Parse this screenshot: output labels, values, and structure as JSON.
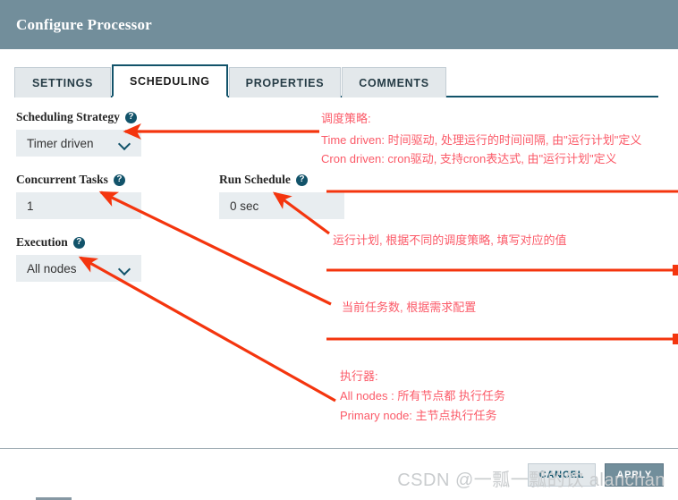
{
  "header": {
    "title": "Configure Processor"
  },
  "tabs": [
    {
      "label": "SETTINGS",
      "active": false
    },
    {
      "label": "SCHEDULING",
      "active": true
    },
    {
      "label": "PROPERTIES",
      "active": false
    },
    {
      "label": "COMMENTS",
      "active": false
    }
  ],
  "form": {
    "scheduling_strategy": {
      "label": "Scheduling Strategy",
      "value": "Timer driven",
      "help": "?"
    },
    "concurrent_tasks": {
      "label": "Concurrent Tasks",
      "value": "1",
      "help": "?"
    },
    "run_schedule": {
      "label": "Run Schedule",
      "value": "0 sec",
      "help": "?"
    },
    "execution": {
      "label": "Execution",
      "value": "All nodes",
      "help": "?"
    }
  },
  "annotations": {
    "strategy": {
      "line1": "调度策略:",
      "line2": "Time driven: 时间驱动, 处理运行的时间间隔, 由\"运行计划\"定义",
      "line3": "Cron driven: cron驱动, 支持cron表达式, 由\"运行计划\"定义"
    },
    "run_schedule": {
      "line1": "运行计划, 根据不同的调度策略, 填写对应的值"
    },
    "concurrent_tasks": {
      "line1": "当前任务数, 根据需求配置"
    },
    "execution": {
      "line1": "执行器:",
      "line2": "All nodes : 所有节点都 执行任务",
      "line3": "Primary node:  主节点执行任务"
    }
  },
  "footer": {
    "cancel_label": "CANCEL",
    "apply_label": "APPLY"
  },
  "watermark": {
    "text": "CSDN @一瓢一瓢的饮 alanchan"
  },
  "colors": {
    "header_bg": "#728e9b",
    "tab_active_border": "#12536a",
    "tab_inactive_bg": "#e3e8eb",
    "input_bg": "#e8edf0",
    "annotation_red": "#fb5a68",
    "arrow_red": "#f4350e",
    "apply_bg": "#728e9b"
  }
}
